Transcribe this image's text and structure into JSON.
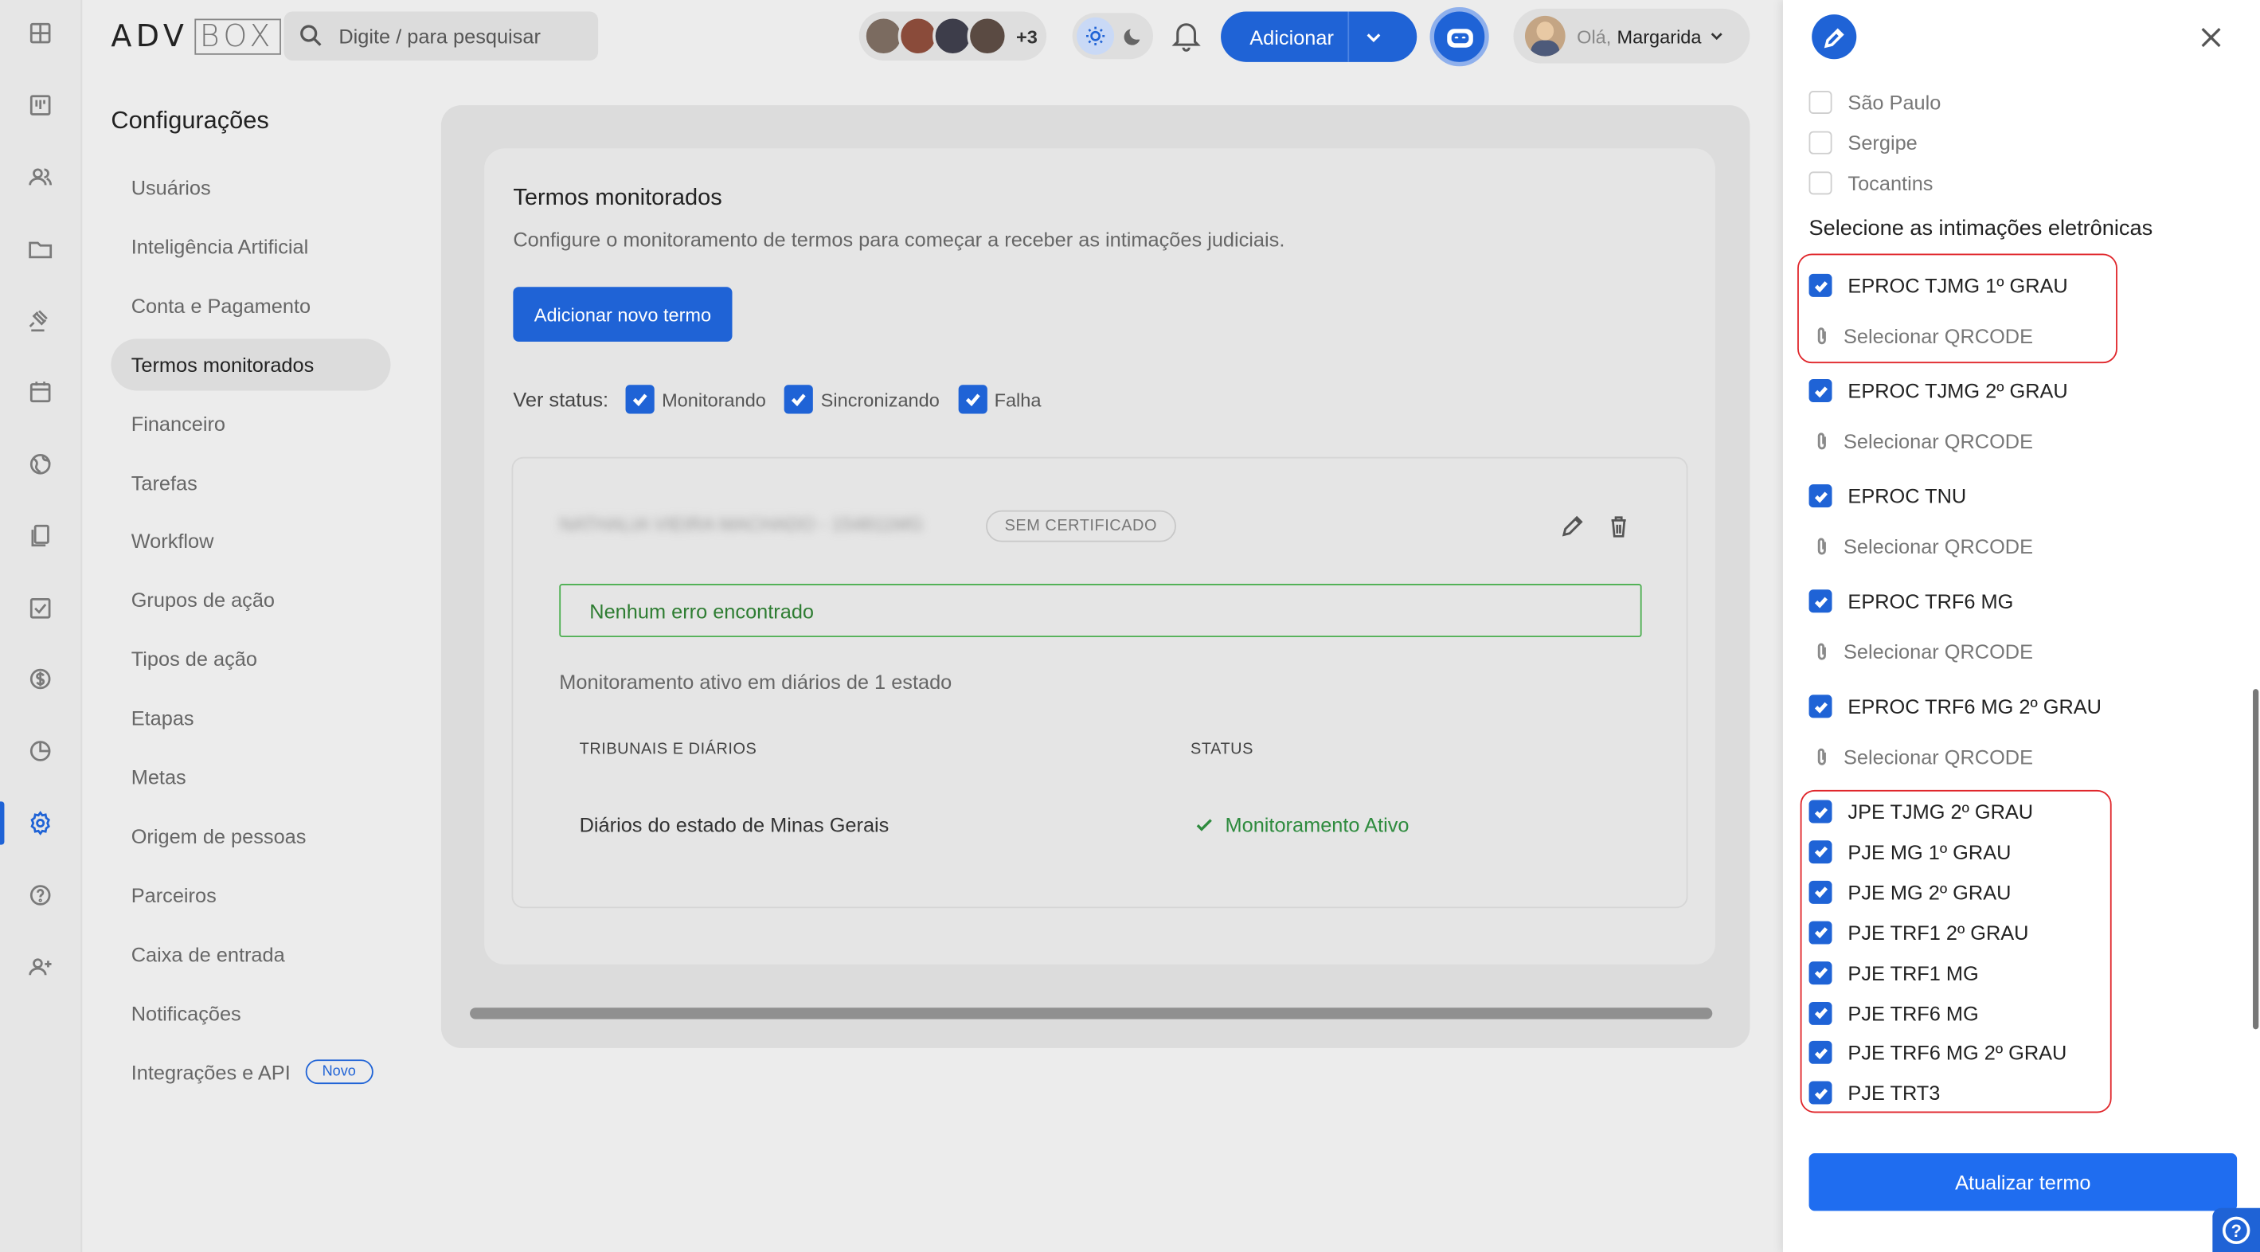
{
  "topbar": {
    "logo_adv": "ADV",
    "logo_box": "BOX",
    "search_placeholder": "Digite / para pesquisar",
    "avatars_more": "+3",
    "add_button": "Adicionar",
    "greeting": "Olá,",
    "user_name": "Margarida"
  },
  "rail_icons": [
    "dashboard-icon",
    "kanban-icon",
    "people-icon",
    "folder-icon",
    "gavel-icon",
    "calendar-icon",
    "globe-icon",
    "documents-icon",
    "checklist-icon",
    "dollar-icon",
    "chart-pie-icon",
    "gear-icon",
    "help-icon",
    "add-user-icon"
  ],
  "settings_nav": {
    "title": "Configurações",
    "items": [
      "Usuários",
      "Inteligência Artificial",
      "Conta e Pagamento",
      "Termos monitorados",
      "Financeiro",
      "Tarefas",
      "Workflow",
      "Grupos de ação",
      "Tipos de ação",
      "Etapas",
      "Metas",
      "Origem de pessoas",
      "Parceiros",
      "Caixa de entrada",
      "Notificações",
      "Integrações e API"
    ],
    "active_index": 3,
    "new_badge": "Novo"
  },
  "main": {
    "title": "Termos monitorados",
    "description": "Configure o monitoramento de termos para começar a receber as intimações judiciais.",
    "add_button": "Adicionar novo termo",
    "status_label": "Ver status:",
    "status_options": [
      "Monitorando",
      "Sincronizando",
      "Falha"
    ],
    "term": {
      "name": "NATHALIA VIEIRA MACHADO - 154811MG",
      "certificate_badge": "SEM CERTIFICADO",
      "error_box": "Nenhum erro encontrado",
      "monitoring_text": "Monitoramento ativo em diários de 1 estado",
      "table_headers": [
        "TRIBUNAIS E DIÁRIOS",
        "STATUS"
      ],
      "rows": [
        {
          "court": "Diários do estado de Minas Gerais",
          "status": "Monitoramento Ativo"
        }
      ]
    }
  },
  "panel": {
    "states": [
      "São Paulo",
      "Sergipe",
      "Tocantins"
    ],
    "intimations_title": "Selecione as intimações eletrônicas",
    "eproc": [
      "EPROC TJMG 1º GRAU",
      "EPROC TJMG 2º GRAU",
      "EPROC TNU",
      "EPROC TRF6 MG",
      "EPROC TRF6 MG 2º GRAU"
    ],
    "qrcode_label": "Selecionar QRCODE",
    "pje": [
      "JPE TJMG 2º GRAU",
      "PJE MG 1º GRAU",
      "PJE MG 2º GRAU",
      "PJE TRF1 2º GRAU",
      "PJE TRF1 MG",
      "PJE TRF6 MG",
      "PJE TRF6 MG 2º GRAU",
      "PJE TRT3"
    ],
    "update_button": "Atualizar termo",
    "help": "?"
  },
  "colors": {
    "primary": "#1f63d6",
    "highlight": "#e0262b",
    "success": "#2e7d32"
  }
}
